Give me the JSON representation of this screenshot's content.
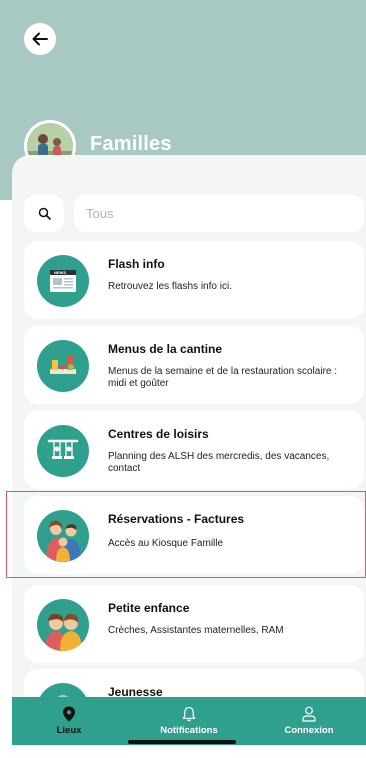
{
  "header": {
    "title": "Familles",
    "background_color": "#a8c8c3"
  },
  "search": {
    "placeholder": "Tous"
  },
  "cards": [
    {
      "title": "Flash info",
      "description": "Retrouvez les flashs info ici.",
      "icon": "news-icon"
    },
    {
      "title": "Menus de la cantine",
      "description": "Menus de la semaine et de la restauration scolaire : midi et goûter",
      "icon": "food-icon"
    },
    {
      "title": "Centres de loisirs",
      "description": "Planning des ALSH des mercredis, des vacances, contact",
      "icon": "swing-icon"
    },
    {
      "title": "Réservations - Factures",
      "description": "Accès au Kiosque Famille",
      "icon": "family-icon"
    },
    {
      "title": "Petite enfance",
      "description": "Crèches, Assistantes maternelles, RAM",
      "icon": "children-icon"
    },
    {
      "title": "Jeunesse",
      "description": "",
      "icon": "youth-icon"
    }
  ],
  "tabbar": {
    "items": [
      {
        "label": "Lieux",
        "icon": "location-pin-icon",
        "active": true
      },
      {
        "label": "Notifications",
        "icon": "bell-icon",
        "active": false
      },
      {
        "label": "Connexion",
        "icon": "user-icon",
        "active": false
      }
    ]
  },
  "colors": {
    "accent": "#2fa08e",
    "highlight_border": "#e0556a"
  }
}
